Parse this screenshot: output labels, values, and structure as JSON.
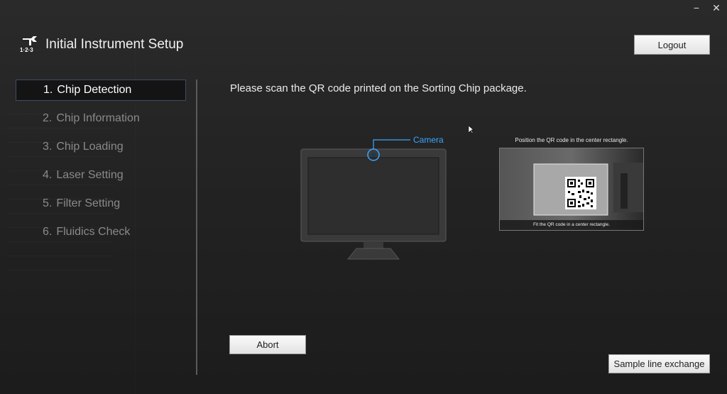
{
  "window": {
    "minimize": "−",
    "close": "✕"
  },
  "header": {
    "title": "Initial Instrument Setup",
    "logo_icon": "wrench-icon",
    "logo_text": "1·2·3"
  },
  "logout_label": "Logout",
  "steps": [
    {
      "number": "1.",
      "label": "Chip Detection",
      "active": true
    },
    {
      "number": "2.",
      "label": "Chip Information",
      "active": false
    },
    {
      "number": "3.",
      "label": "Chip Loading",
      "active": false
    },
    {
      "number": "4.",
      "label": "Laser Setting",
      "active": false
    },
    {
      "number": "5.",
      "label": "Filter Setting",
      "active": false
    },
    {
      "number": "6.",
      "label": "Fluidics Check",
      "active": false
    }
  ],
  "instruction": "Please scan the QR code printed on the Sorting Chip package.",
  "camera_label": "Camera",
  "qr": {
    "caption": "Position the QR code in the center rectangle.",
    "fit_text": "Fit the QR code in a center rectangle."
  },
  "buttons": {
    "abort": "Abort",
    "sample_line": "Sample line exchange"
  },
  "colors": {
    "accent": "#3aa6ff",
    "active_step_border": "#3c4c66"
  }
}
